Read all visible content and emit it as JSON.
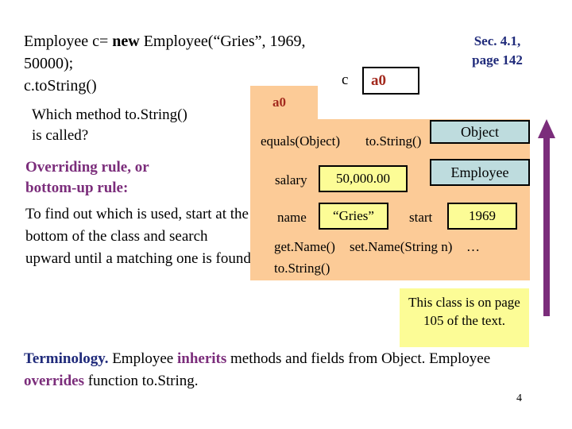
{
  "slide": {
    "page_number": "4",
    "colors": {
      "object_fill": "#FCCB97",
      "value_box_fill": "#FCFC96",
      "class_box_fill": "#BEDCDE",
      "accent_purple": "#7B2D7B",
      "accent_navy": "#1F2A7A",
      "pointer_red": "#A32A1E"
    }
  },
  "code": {
    "line1_pre": "Employee c= ",
    "line1_kw": "new",
    "line1_post": " Employee(“Gries”, 1969, 50000);",
    "line2": "c.toString()"
  },
  "sec_note": {
    "line1": "Sec. 4.1,",
    "line2": "page 142"
  },
  "variable": {
    "label": "c",
    "value": "a0"
  },
  "question": {
    "line1": "Which method to.String()",
    "line2": "is called?"
  },
  "rule": {
    "heading_line1": "Overriding rule, or",
    "heading_line2": "bottom-up rule:",
    "body": "To find out which is used, start at the bottom of the class and search upward until a matching one is found."
  },
  "object_diagram": {
    "tab_label": "a0",
    "object_methods": [
      "equals(Object)",
      "to.String()"
    ],
    "fields": [
      {
        "name": "salary",
        "value": "50,000.00"
      },
      {
        "name": "name",
        "value": "“Gries”"
      },
      {
        "name": "start",
        "value": "1969"
      }
    ],
    "employee_methods": [
      "get.Name()",
      "set.Name(String n)",
      "…",
      "to.String()"
    ],
    "class_labels": {
      "super": "Object",
      "sub": "Employee"
    }
  },
  "callout": {
    "text": "This class is on page 105 of the text."
  },
  "terminology": {
    "lead": "Terminology.",
    "part1": " Employee ",
    "kw1": "inherits",
    "part2": " methods and fields from Object. Employee ",
    "kw2": "overrides",
    "part3": " function to.String."
  }
}
